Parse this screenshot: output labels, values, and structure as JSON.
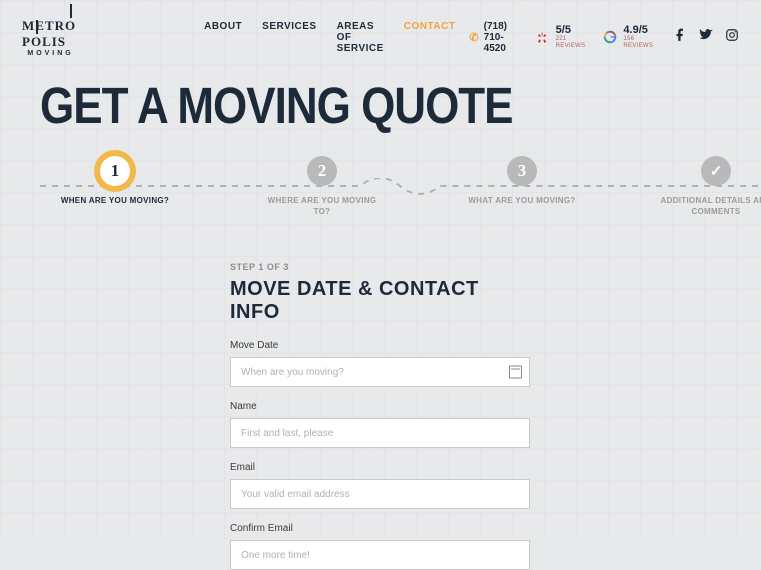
{
  "brand": {
    "name": "METROPOLIS",
    "sub": "MOVING"
  },
  "nav": {
    "about": "ABOUT",
    "services": "SERVICES",
    "areas": "AREAS OF SERVICE",
    "contact": "CONTACT"
  },
  "phone": "(718) 710-4520",
  "reviews": {
    "yelp": {
      "score": "5/5",
      "count": "221 REVIEWS"
    },
    "google": {
      "score": "4.9/5",
      "count": "156 REVIEWS"
    }
  },
  "title": "GET A MOVING QUOTE",
  "steps": {
    "s1": {
      "num": "1",
      "label": "WHEN ARE YOU MOVING?"
    },
    "s2": {
      "num": "2",
      "label": "WHERE ARE YOU MOVING TO?"
    },
    "s3": {
      "num": "3",
      "label": "WHAT ARE YOU MOVING?"
    },
    "s4": {
      "label": "ADDITIONAL DETAILS AND COMMENTS"
    }
  },
  "form": {
    "stepof": "STEP 1 OF 3",
    "heading": "MOVE DATE & CONTACT INFO",
    "move_date": {
      "label": "Move Date",
      "placeholder": "When are you moving?"
    },
    "name": {
      "label": "Name",
      "placeholder": "First and last, please"
    },
    "email": {
      "label": "Email",
      "placeholder": "Your valid email address"
    },
    "confirm": {
      "label": "Confirm Email",
      "placeholder": "One more time!"
    }
  }
}
